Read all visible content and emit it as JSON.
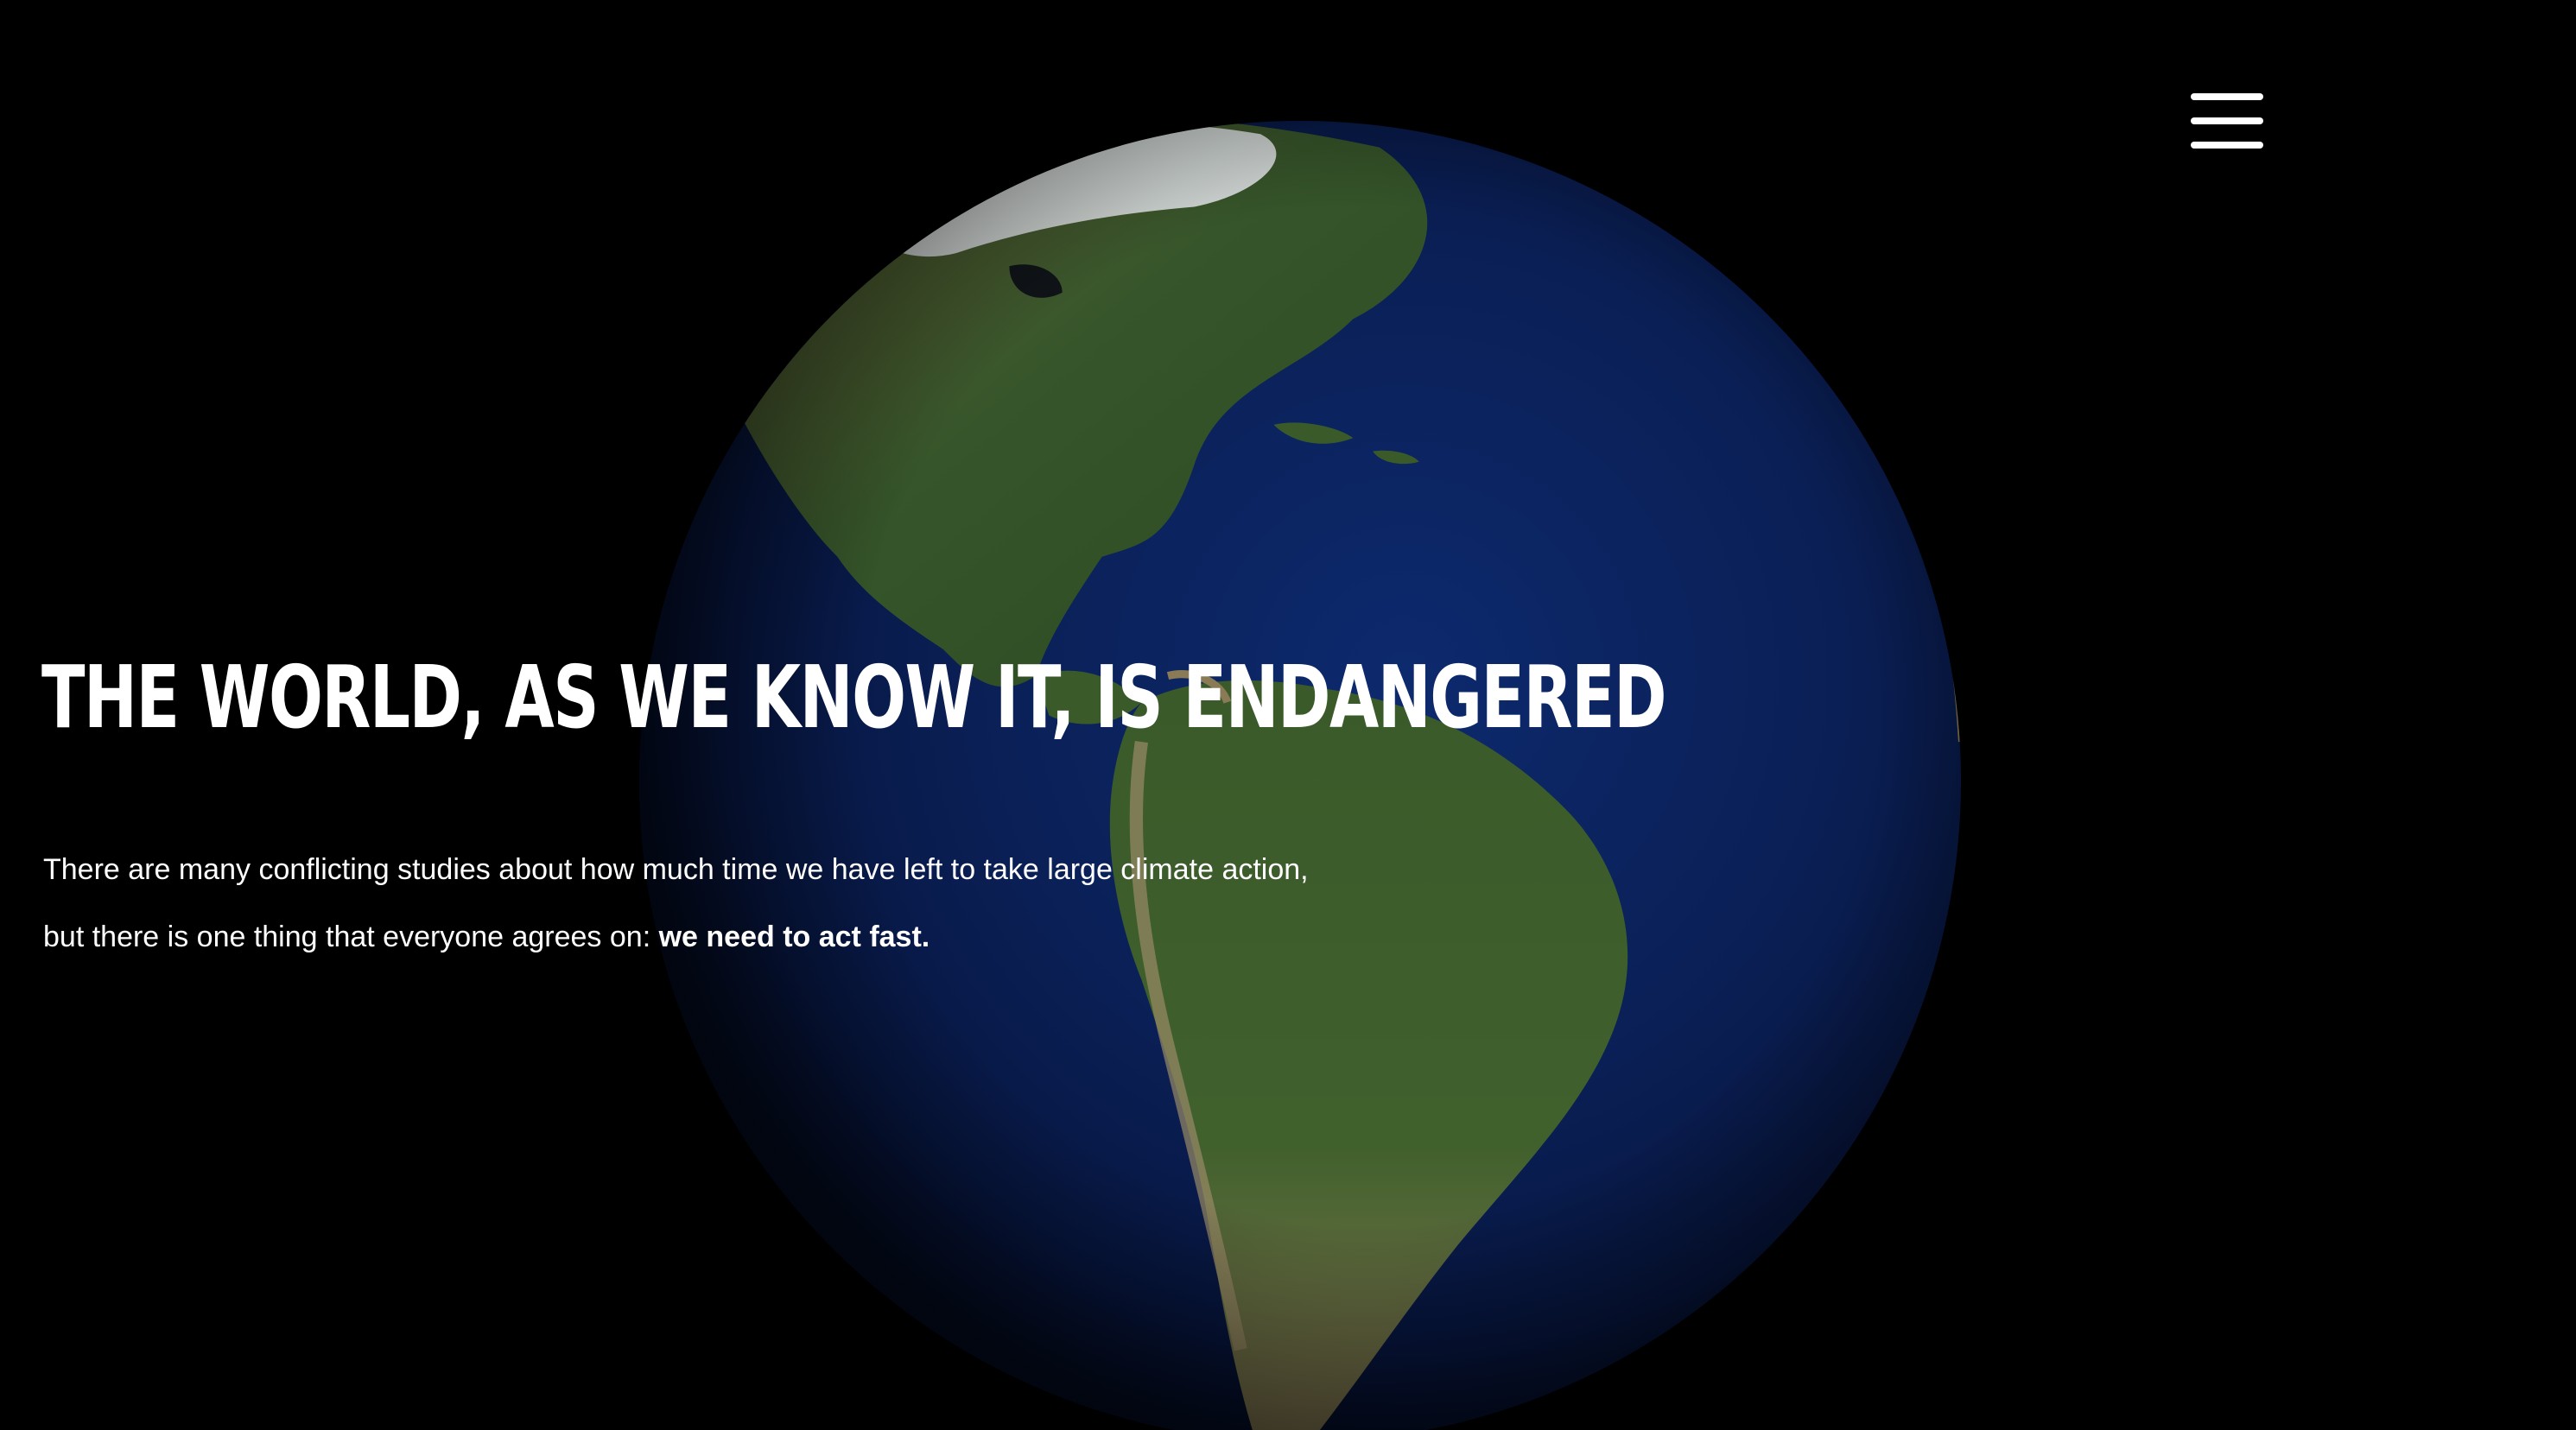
{
  "hero": {
    "title": "THE WORLD, AS WE KNOW IT, IS ENDANGERED",
    "body_line1": "There are many conflicting studies about how much time we have left to take large climate action,",
    "body_line2_prefix": "but there is one thing that everyone agrees on: ",
    "body_line2_emphasis": "we need to act fast."
  },
  "menu": {
    "icon": "hamburger-menu-icon"
  },
  "background": {
    "image": "earth-globe-americas",
    "color": "#000000"
  },
  "colors": {
    "text": "#ffffff",
    "ocean": "#0b1d4d",
    "land": "#3a5a2a"
  }
}
